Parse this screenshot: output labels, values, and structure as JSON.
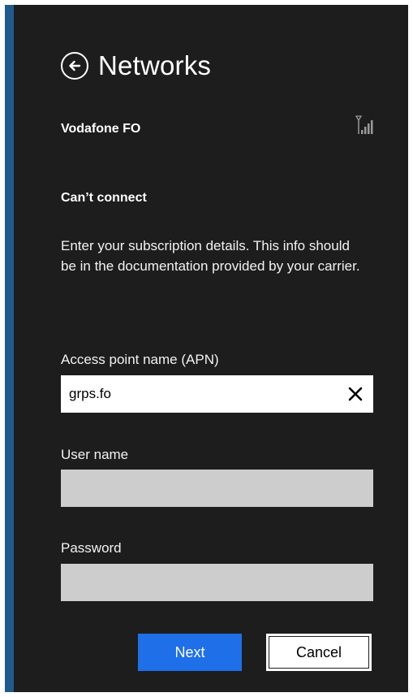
{
  "header": {
    "title": "Networks",
    "back_icon": "back-arrow-circle-icon"
  },
  "network": {
    "name": "Vodafone FO",
    "signal_icon": "cellular-signal-icon"
  },
  "status": "Can’t connect",
  "description": "Enter your subscription details. This info should be in the documentation provided by your carrier.",
  "form": {
    "apn": {
      "label": "Access point name (APN)",
      "value": "grps.fo",
      "clear_icon": "clear-x-icon"
    },
    "username": {
      "label": "User name",
      "value": ""
    },
    "password": {
      "label": "Password",
      "value": ""
    }
  },
  "buttons": {
    "next": "Next",
    "cancel": "Cancel"
  },
  "colors": {
    "panel_background": "#1d1d1d",
    "accent_bar": "#1f5a8c",
    "primary_button": "#1f6fe8",
    "disabled_field": "#cdcdcd"
  }
}
